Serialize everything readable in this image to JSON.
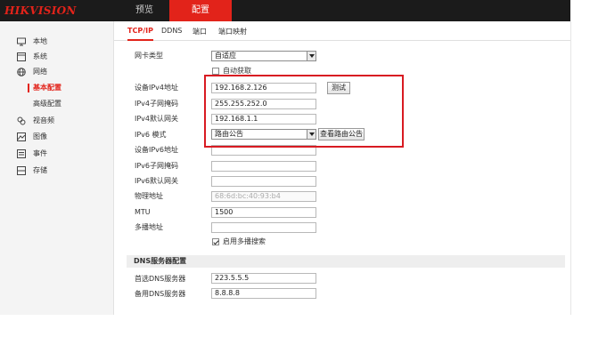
{
  "header": {
    "logo": "HIKVISION",
    "tabs": [
      "预览",
      "配置"
    ]
  },
  "sidebar": {
    "items": [
      {
        "label": "本地",
        "icon": "monitor-icon"
      },
      {
        "label": "系统",
        "icon": "system-icon"
      },
      {
        "label": "网络",
        "icon": "globe-icon"
      },
      {
        "label": "基本配置",
        "icon": ""
      },
      {
        "label": "高级配置",
        "icon": ""
      },
      {
        "label": "视音频",
        "icon": "audio-video-icon"
      },
      {
        "label": "图像",
        "icon": "image-icon"
      },
      {
        "label": "事件",
        "icon": "event-icon"
      },
      {
        "label": "存储",
        "icon": "storage-icon"
      }
    ]
  },
  "subtabs": [
    "TCP/IP",
    "DDNS",
    "端口",
    "端口映射"
  ],
  "form": {
    "nic_type_label": "网卡类型",
    "nic_type_value": "自适应",
    "dhcp_label": "自动获取",
    "ipv4_addr_label": "设备IPv4地址",
    "ipv4_addr_value": "192.168.2.126",
    "test_button": "测试",
    "ipv4_mask_label": "IPv4子网掩码",
    "ipv4_mask_value": "255.255.252.0",
    "ipv4_gw_label": "IPv4默认网关",
    "ipv4_gw_value": "192.168.1.1",
    "ipv6_mode_label": "IPv6 模式",
    "ipv6_mode_value": "路由公告",
    "view_route_button": "查看路由公告",
    "ipv6_addr_label": "设备IPv6地址",
    "ipv6_mask_label": "IPv6子网掩码",
    "ipv6_gw_label": "IPv6默认网关",
    "mac_label": "物理地址",
    "mac_value": "68:6d:bc:40:93:b4",
    "mtu_label": "MTU",
    "mtu_value": "1500",
    "multicast_label": "多播地址",
    "multicast_search_label": "启用多播搜索",
    "dns_section_title": "DNS服务器配置",
    "dns1_label": "首选DNS服务器",
    "dns1_value": "223.5.5.5",
    "dns2_label": "备用DNS服务器",
    "dns2_value": "8.8.8.8"
  },
  "colors": {
    "accent": "#e2231a",
    "topbar": "#1b1b1b",
    "highlight": "#d81b22"
  }
}
